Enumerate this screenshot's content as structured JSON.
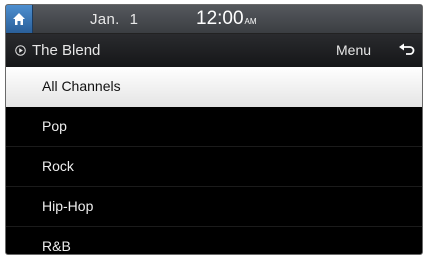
{
  "status_bar": {
    "date_month": "Jan.",
    "date_day": "1",
    "time": "12:00",
    "ampm": "AM"
  },
  "title_bar": {
    "station": "The Blend",
    "menu_label": "Menu"
  },
  "channels": [
    {
      "label": "All Channels",
      "selected": true
    },
    {
      "label": "Pop",
      "selected": false
    },
    {
      "label": "Rock",
      "selected": false
    },
    {
      "label": "Hip-Hop",
      "selected": false
    },
    {
      "label": "R&B",
      "selected": false
    }
  ],
  "icons": {
    "home": "home-icon",
    "play": "play-circle-icon",
    "back": "back-arrow-icon"
  },
  "colors": {
    "home_button": "#3a78b8",
    "selected_row": "#f2f2f2",
    "background": "#000000"
  }
}
